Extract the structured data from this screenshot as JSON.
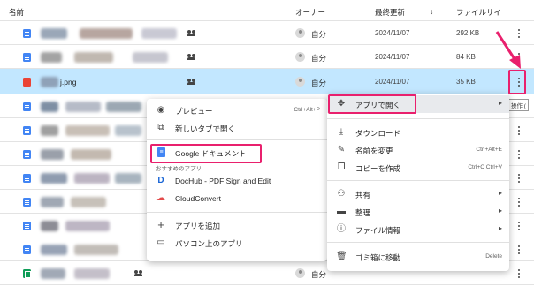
{
  "header": {
    "name_col": "名前",
    "owner_col": "オーナー",
    "modified_col": "最終更新",
    "sort_arrow": "↓",
    "size_col": "ファイルサイ"
  },
  "rows": [
    {
      "owner": "自分",
      "date": "2024/11/07",
      "size": "292 KB"
    },
    {
      "owner": "自分",
      "date": "2024/11/07",
      "size": "84 KB"
    },
    {
      "name": "j.png",
      "owner": "自分",
      "date": "2024/11/07",
      "size": "35 KB"
    },
    {
      "owner": "",
      "date": "",
      "size": ""
    },
    {
      "owner": "自分",
      "date": "",
      "size": ""
    }
  ],
  "open_with_menu": {
    "items": [
      {
        "label": "プレビュー",
        "shortcut": "Ctrl+Alt+P",
        "icon": "eye-icon"
      },
      {
        "label": "新しいタブで開く",
        "icon": "open-new-tab-icon"
      },
      {
        "label": "Google ドキュメント",
        "icon": "google-docs-icon"
      }
    ],
    "suggested_header": "おすすめのアプリ",
    "apps": [
      {
        "label": "DocHub - PDF Sign and Edit",
        "icon": "dochub-icon"
      },
      {
        "label": "CloudConvert",
        "icon": "cloudconvert-icon"
      }
    ],
    "bottom": [
      {
        "label": "アプリを追加",
        "icon": "plus-icon"
      },
      {
        "label": "パソコン上のアプリ",
        "icon": "computer-icon"
      }
    ]
  },
  "context_menu": {
    "open_with": {
      "label": "アプリで開く",
      "icon": "open-with-icon"
    },
    "items": [
      {
        "label": "ダウンロード",
        "icon": "download-icon"
      },
      {
        "label": "名前を変更",
        "shortcut": "Ctrl+Alt+E",
        "icon": "rename-icon"
      },
      {
        "label": "コピーを作成",
        "shortcut": "Ctrl+C Ctrl+V",
        "icon": "copy-icon"
      },
      {
        "label": "共有",
        "icon": "share-icon"
      },
      {
        "label": "整理",
        "icon": "folder-icon"
      },
      {
        "label": "ファイル情報",
        "icon": "info-icon"
      },
      {
        "label": "ゴミ箱に移動",
        "shortcut": "Delete",
        "icon": "trash-icon"
      }
    ]
  },
  "tooltip": "操作 (",
  "colors": {
    "selected_row": "#c2e7ff",
    "highlight": "#e9206d",
    "doc_blue": "#4285f4"
  }
}
